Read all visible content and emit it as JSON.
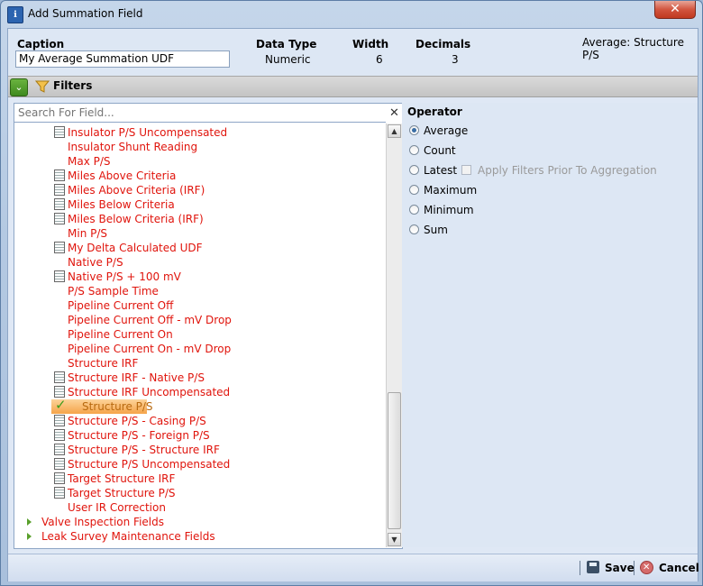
{
  "window": {
    "title": "Add Summation Field",
    "close_label": "✕"
  },
  "header": {
    "caption_label": "Caption",
    "caption_value": "My Average Summation UDF",
    "data_type_label": "Data Type",
    "data_type_value": "Numeric",
    "width_label": "Width",
    "width_value": "6",
    "decimals_label": "Decimals",
    "decimals_value": "3",
    "summary": "Average: Structure P/S"
  },
  "filters": {
    "label": "Filters"
  },
  "search": {
    "placeholder": "Search For Field..."
  },
  "tree": {
    "items": [
      {
        "label": "Insulator P/S Uncompensated",
        "icon": "calculator-icon"
      },
      {
        "label": "Insulator Shunt Reading",
        "icon": ""
      },
      {
        "label": "Max P/S",
        "icon": ""
      },
      {
        "label": "Miles Above Criteria",
        "icon": "calculator-icon"
      },
      {
        "label": "Miles Above Criteria (IRF)",
        "icon": "calculator-icon"
      },
      {
        "label": "Miles Below Criteria",
        "icon": "calculator-icon"
      },
      {
        "label": "Miles Below Criteria (IRF)",
        "icon": "calculator-icon"
      },
      {
        "label": "Min P/S",
        "icon": ""
      },
      {
        "label": "My Delta Calculated UDF",
        "icon": "calculator-icon"
      },
      {
        "label": "Native P/S",
        "icon": ""
      },
      {
        "label": "Native P/S + 100 mV",
        "icon": "calculator-icon"
      },
      {
        "label": "P/S Sample Time",
        "icon": ""
      },
      {
        "label": "Pipeline Current Off",
        "icon": ""
      },
      {
        "label": "Pipeline Current Off - mV Drop",
        "icon": ""
      },
      {
        "label": "Pipeline Current On",
        "icon": ""
      },
      {
        "label": "Pipeline Current On - mV Drop",
        "icon": ""
      },
      {
        "label": "Structure IRF",
        "icon": ""
      },
      {
        "label": "Structure IRF - Native P/S",
        "icon": "calculator-icon"
      },
      {
        "label": "Structure IRF Uncompensated",
        "icon": "calculator-icon"
      },
      {
        "label": "Structure P/S",
        "icon": "check-icon",
        "selected": true
      },
      {
        "label": "Structure P/S - Casing P/S",
        "icon": "calculator-icon"
      },
      {
        "label": "Structure P/S - Foreign P/S",
        "icon": "calculator-icon"
      },
      {
        "label": "Structure P/S - Structure IRF",
        "icon": "calculator-icon"
      },
      {
        "label": "Structure P/S Uncompensated",
        "icon": "calculator-icon"
      },
      {
        "label": "Target Structure IRF",
        "icon": "calculator-icon"
      },
      {
        "label": "Target Structure P/S",
        "icon": "calculator-icon"
      },
      {
        "label": "User IR Correction",
        "icon": ""
      }
    ],
    "groups": [
      {
        "label": "Valve Inspection Fields",
        "icon": "expand-triangle-icon"
      },
      {
        "label": "Leak Survey Maintenance Fields",
        "icon": "expand-triangle-icon"
      }
    ]
  },
  "operator": {
    "title": "Operator",
    "options": [
      "Average",
      "Count",
      "Latest",
      "Maximum",
      "Minimum",
      "Sum"
    ],
    "selected": "Average",
    "apply_filters_label": "Apply Filters Prior To Aggregation"
  },
  "footer": {
    "save_label": "Save",
    "cancel_label": "Cancel"
  },
  "colors": {
    "field_text": "#e0140c",
    "selection": "#f5a44a",
    "expand_button": "#4a9a26"
  }
}
